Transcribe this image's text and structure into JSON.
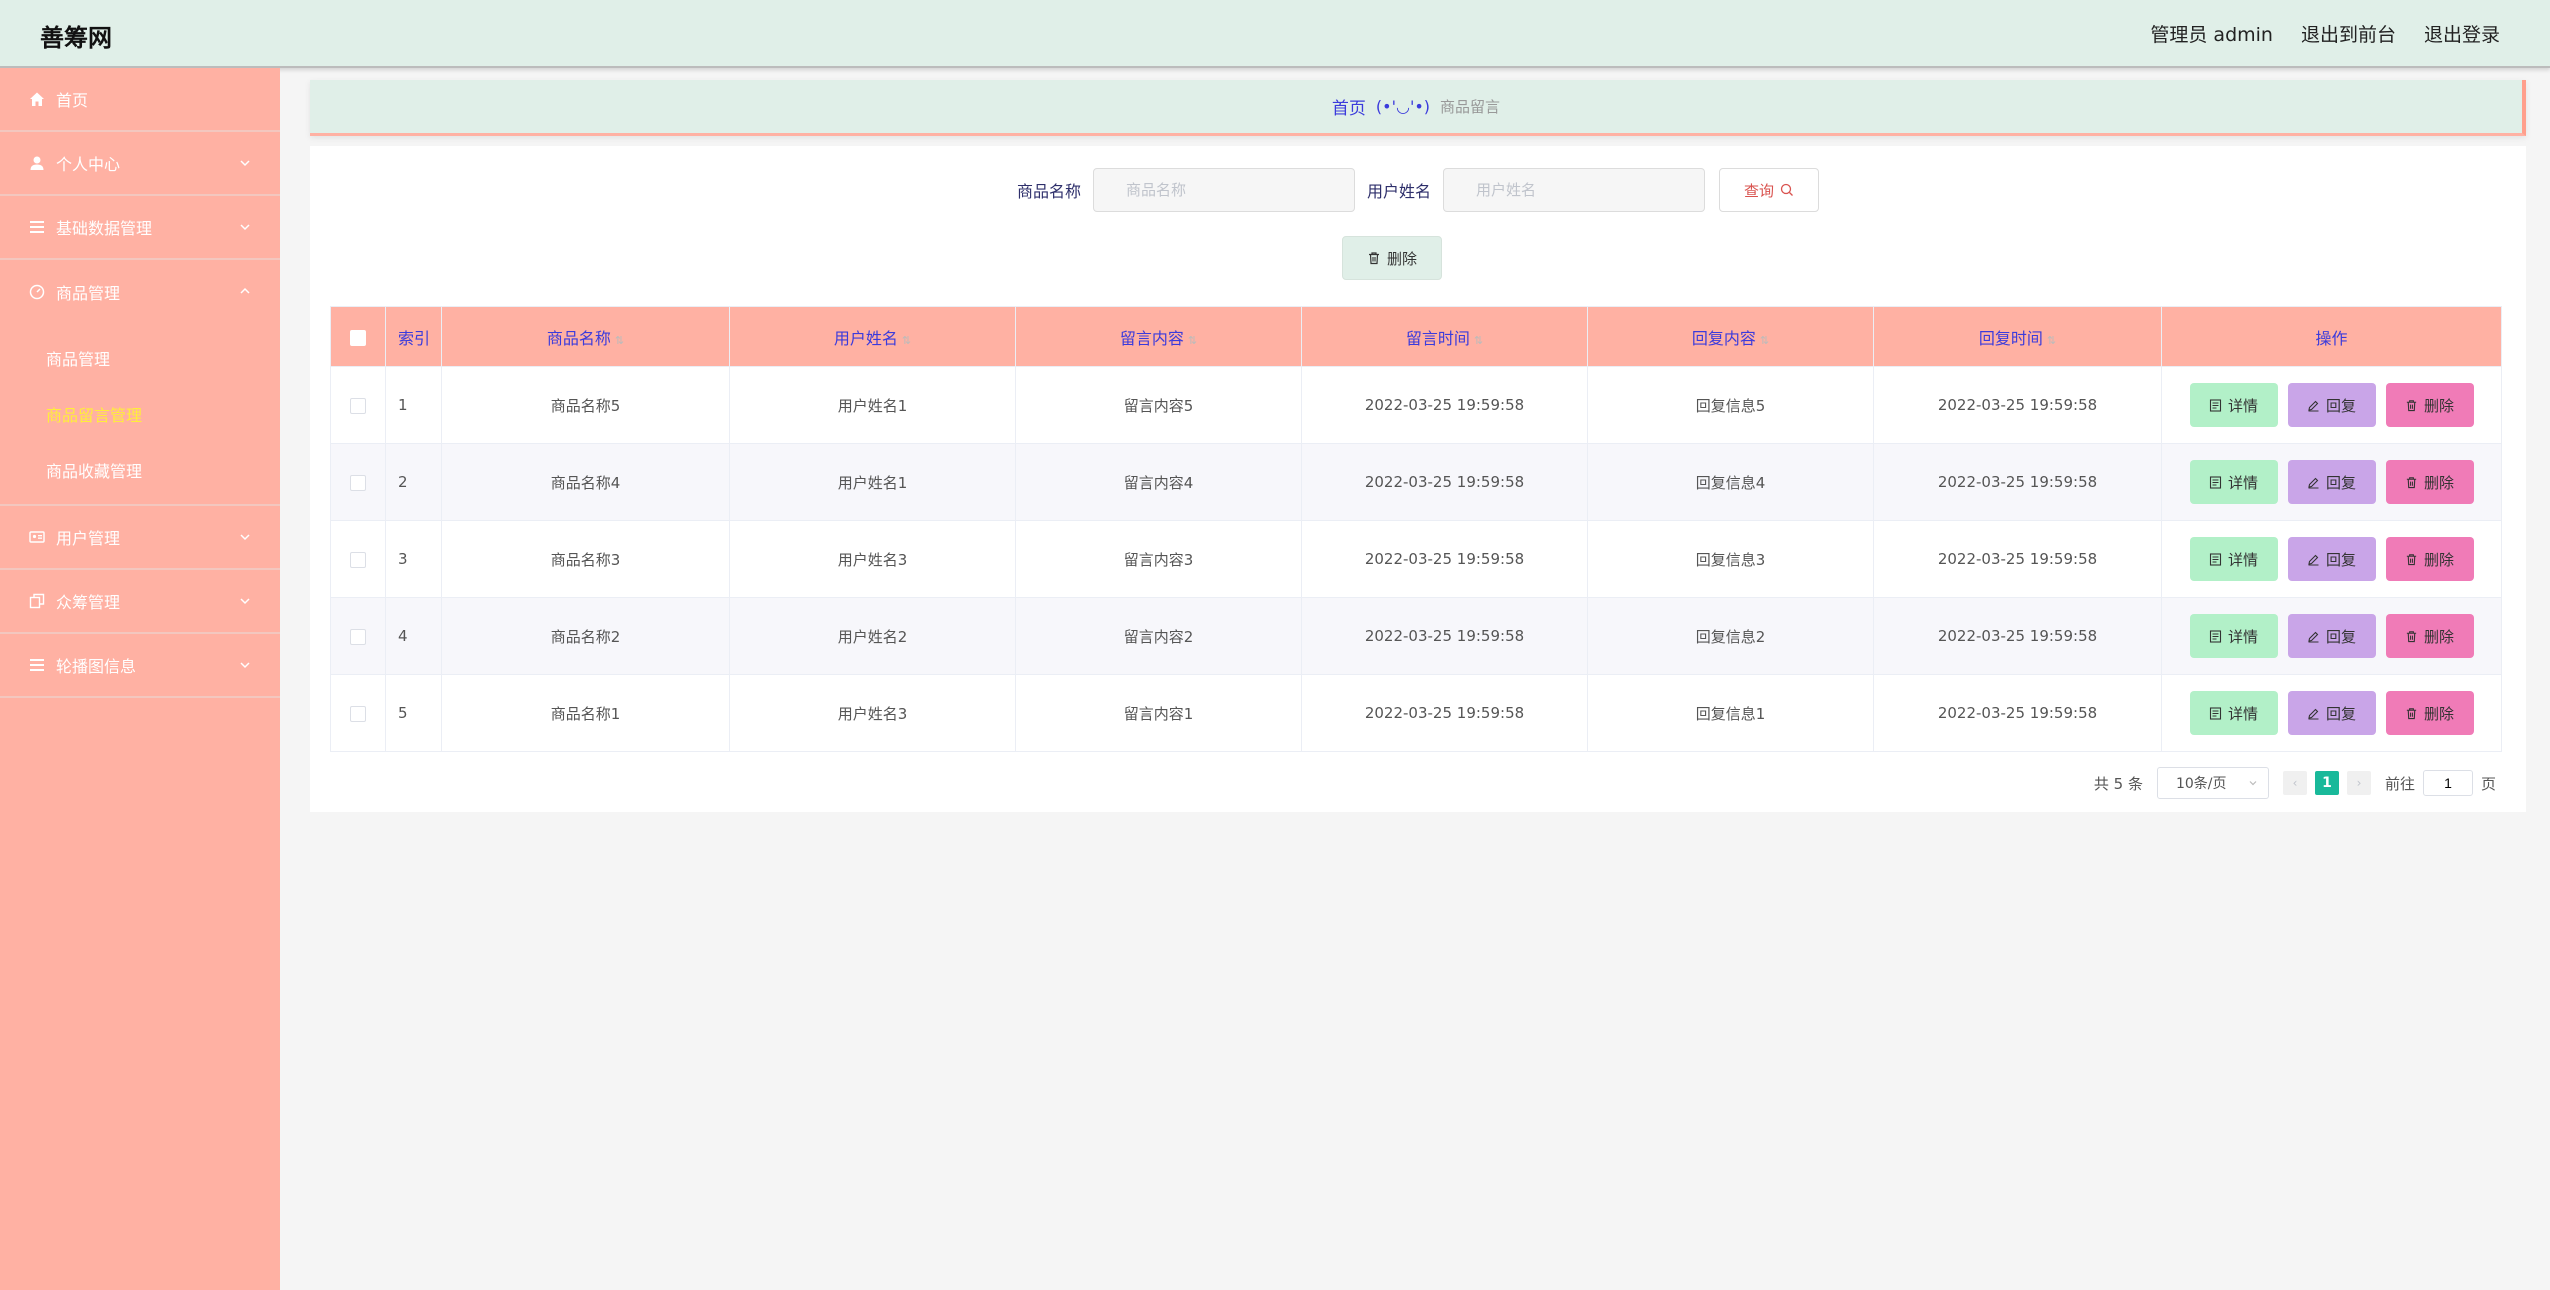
{
  "header": {
    "brand": "善筹网",
    "admin_label": "管理员 admin",
    "frontend_link": "退出到前台",
    "logout_link": "退出登录"
  },
  "sidebar": {
    "home": "首页",
    "personal_center": "个人中心",
    "basic_data": "基础数据管理",
    "goods_mgmt": "商品管理",
    "sub_goods": "商品管理",
    "sub_goods_message": "商品留言管理",
    "sub_goods_favorite": "商品收藏管理",
    "user_mgmt": "用户管理",
    "crowdfunding_mgmt": "众筹管理",
    "carousel_info": "轮播图信息"
  },
  "breadcrumb": {
    "home": "首页",
    "face": "(•'◡'•)",
    "current": "商品留言"
  },
  "search": {
    "goods_label": "商品名称",
    "goods_placeholder": "商品名称",
    "user_label": "用户姓名",
    "user_placeholder": "用户姓名",
    "query_button": "查询"
  },
  "batch_delete": "删除",
  "table": {
    "headers": {
      "index": "索引",
      "goods_name": "商品名称",
      "user_name": "用户姓名",
      "message": "留言内容",
      "message_time": "留言时间",
      "reply": "回复内容",
      "reply_time": "回复时间",
      "actions": "操作"
    },
    "rows": [
      {
        "index": "1",
        "goods_name": "商品名称5",
        "user_name": "用户姓名1",
        "message": "留言内容5",
        "message_time": "2022-03-25 19:59:58",
        "reply": "回复信息5",
        "reply_time": "2022-03-25 19:59:58"
      },
      {
        "index": "2",
        "goods_name": "商品名称4",
        "user_name": "用户姓名1",
        "message": "留言内容4",
        "message_time": "2022-03-25 19:59:58",
        "reply": "回复信息4",
        "reply_time": "2022-03-25 19:59:58"
      },
      {
        "index": "3",
        "goods_name": "商品名称3",
        "user_name": "用户姓名3",
        "message": "留言内容3",
        "message_time": "2022-03-25 19:59:58",
        "reply": "回复信息3",
        "reply_time": "2022-03-25 19:59:58"
      },
      {
        "index": "4",
        "goods_name": "商品名称2",
        "user_name": "用户姓名2",
        "message": "留言内容2",
        "message_time": "2022-03-25 19:59:58",
        "reply": "回复信息2",
        "reply_time": "2022-03-25 19:59:58"
      },
      {
        "index": "5",
        "goods_name": "商品名称1",
        "user_name": "用户姓名3",
        "message": "留言内容1",
        "message_time": "2022-03-25 19:59:58",
        "reply": "回复信息1",
        "reply_time": "2022-03-25 19:59:58"
      }
    ],
    "actions": {
      "detail": "详情",
      "reply": "回复",
      "delete": "删除"
    }
  },
  "pagination": {
    "total": "共 5 条",
    "page_size": "10条/页",
    "current_page": "1",
    "goto_label": "前往",
    "goto_value": "1",
    "page_suffix": "页"
  },
  "colors": {
    "sidebar_bg": "#ffb1a3",
    "header_bg": "#e0efe8",
    "accent_text": "#3b3bdc",
    "active_submenu": "#ffee3b",
    "detail_btn": "#b2f0c8",
    "reply_btn": "#c9a5e8",
    "delete_btn": "#f07bb7",
    "pager_active": "#19b99a"
  }
}
